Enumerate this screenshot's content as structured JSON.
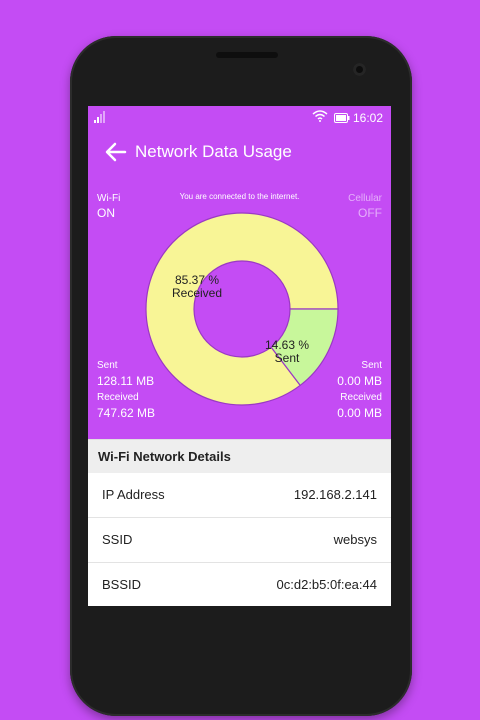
{
  "status": {
    "time": "16:02"
  },
  "appbar": {
    "title": "Network Data Usage"
  },
  "wifi": {
    "label": "Wi-Fi",
    "state": "ON",
    "sent_label": "Sent",
    "sent": "128.11 MB",
    "received_label": "Received",
    "received": "747.62 MB"
  },
  "cellular": {
    "label": "Cellular",
    "state": "OFF",
    "sent_label": "Sent",
    "sent": "0.00 MB",
    "received_label": "Received",
    "received": "0.00 MB"
  },
  "connection_message": "You are connected to the internet.",
  "chart_data": {
    "type": "pie",
    "slices": [
      {
        "name": "Received",
        "value": 85.37,
        "label": "85.37 %",
        "color": "#f8f596"
      },
      {
        "name": "Sent",
        "value": 14.63,
        "label": "14.63 %",
        "color": "#c8f79b"
      }
    ]
  },
  "details": {
    "title": "Wi-Fi Network Details",
    "rows": [
      {
        "label": "IP Address",
        "value": "192.168.2.141"
      },
      {
        "label": "SSID",
        "value": "websys"
      },
      {
        "label": "BSSID",
        "value": "0c:d2:b5:0f:ea:44"
      }
    ]
  },
  "colors": {
    "background": "#c44cf4",
    "received": "#f8f596",
    "sent": "#c8f79b"
  }
}
